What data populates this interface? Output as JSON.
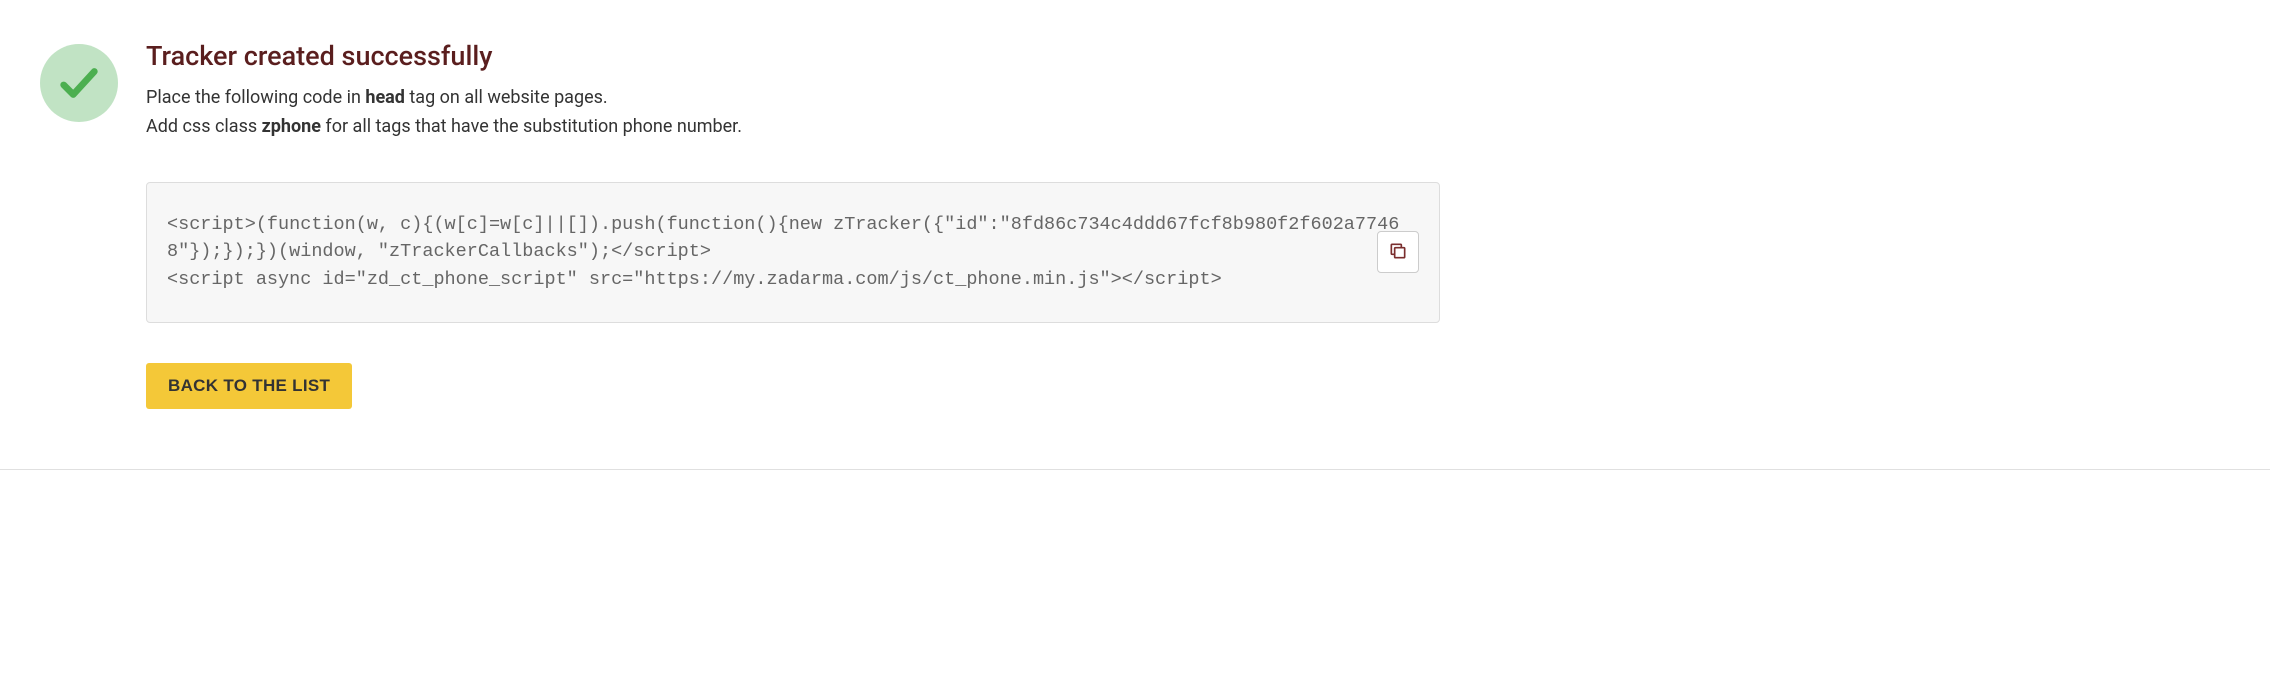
{
  "title": "Tracker created successfully",
  "instructions": {
    "line1_before": "Place the following code in ",
    "line1_bold": "head",
    "line1_after": " tag on all website pages.",
    "line2_before": "Add css class ",
    "line2_bold": "zphone",
    "line2_after": " for all tags that have the substitution phone number."
  },
  "code": "<script>(function(w, c){(w[c]=w[c]||[]).push(function(){new zTracker({\"id\":\"8fd86c734c4ddd67fcf8b980f2f602a77468\"});});})(window, \"zTrackerCallbacks\");</script>\n<script async id=\"zd_ct_phone_script\" src=\"https://my.zadarma.com/js/ct_phone.min.js\"></script>",
  "backButton": "BACK TO THE LIST"
}
